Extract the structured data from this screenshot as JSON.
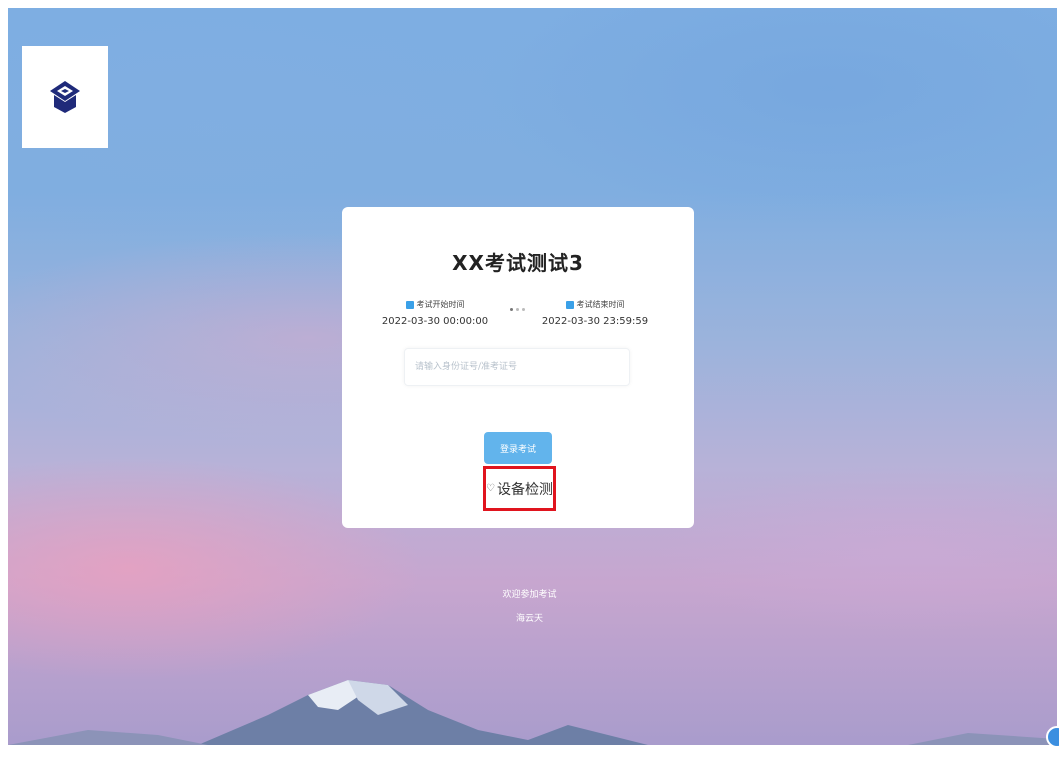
{
  "exam": {
    "title": "XX考试测试3",
    "start_label": "考试开始时间",
    "start_value": "2022-03-30 00:00:00",
    "end_label": "考试结束时间",
    "end_value": "2022-03-30 23:59:59"
  },
  "login": {
    "placeholder": "请输入身份证号/准考证号",
    "button_label": "登录考试",
    "device_check_label": "设备检测"
  },
  "footer": {
    "welcome": "欢迎参加考试",
    "org": "海云天"
  },
  "icons": {
    "logo": "graduation-cap-logo-icon",
    "start_time": "calendar-icon",
    "end_time": "calendar-icon",
    "device_check": "lightbulb-icon",
    "help": "help-icon"
  },
  "colors": {
    "button": "#62b4ec",
    "highlight_border": "#e0141e",
    "logo": "#1f2a7a"
  }
}
